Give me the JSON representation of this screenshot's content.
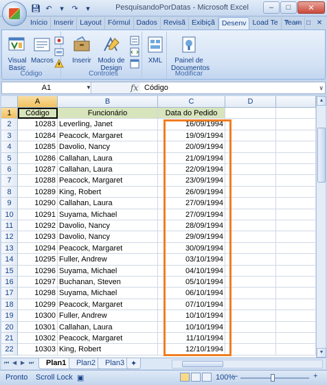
{
  "window": {
    "title": "PesquisandoPorDatas - Microsoft Excel",
    "minimize": "–",
    "maximize": "□",
    "close": "✕"
  },
  "tabs": [
    "Início",
    "Inserir",
    "Layout",
    "Fórmul",
    "Dados",
    "Revisã",
    "Exibiçã",
    "Desenv",
    "Load Te",
    "Team"
  ],
  "active_tab": "Desenv",
  "ribbon": {
    "groups": [
      {
        "label": "Código",
        "buttons": [
          "Visual Basic",
          "Macros"
        ]
      },
      {
        "label": "Controles",
        "buttons": [
          "Inserir",
          "Modo de Design"
        ]
      },
      {
        "label": "",
        "buttons": [
          "XML"
        ]
      },
      {
        "label": "Modificar",
        "buttons": [
          "Painel de Documentos"
        ]
      }
    ]
  },
  "formula_bar": {
    "name_box": "A1",
    "fx": "fx",
    "value": "Código"
  },
  "columns": [
    "A",
    "B",
    "C",
    "D"
  ],
  "header_row": {
    "row": "1",
    "A": "Código",
    "B": "Funcionário",
    "C": "Data do Pedido"
  },
  "rows": [
    {
      "row": "2",
      "A": "10283",
      "B": "Leverling, Janet",
      "C": "16/09/1994"
    },
    {
      "row": "3",
      "A": "10284",
      "B": "Peacock, Margaret",
      "C": "19/09/1994"
    },
    {
      "row": "4",
      "A": "10285",
      "B": "Davolio, Nancy",
      "C": "20/09/1994"
    },
    {
      "row": "5",
      "A": "10286",
      "B": "Callahan, Laura",
      "C": "21/09/1994"
    },
    {
      "row": "6",
      "A": "10287",
      "B": "Callahan, Laura",
      "C": "22/09/1994"
    },
    {
      "row": "7",
      "A": "10288",
      "B": "Peacock, Margaret",
      "C": "23/09/1994"
    },
    {
      "row": "8",
      "A": "10289",
      "B": "King, Robert",
      "C": "26/09/1994"
    },
    {
      "row": "9",
      "A": "10290",
      "B": "Callahan, Laura",
      "C": "27/09/1994"
    },
    {
      "row": "10",
      "A": "10291",
      "B": "Suyama, Michael",
      "C": "27/09/1994"
    },
    {
      "row": "11",
      "A": "10292",
      "B": "Davolio, Nancy",
      "C": "28/09/1994"
    },
    {
      "row": "12",
      "A": "10293",
      "B": "Davolio, Nancy",
      "C": "29/09/1994"
    },
    {
      "row": "13",
      "A": "10294",
      "B": "Peacock, Margaret",
      "C": "30/09/1994"
    },
    {
      "row": "14",
      "A": "10295",
      "B": "Fuller, Andrew",
      "C": "03/10/1994"
    },
    {
      "row": "15",
      "A": "10296",
      "B": "Suyama, Michael",
      "C": "04/10/1994"
    },
    {
      "row": "16",
      "A": "10297",
      "B": "Buchanan, Steven",
      "C": "05/10/1994"
    },
    {
      "row": "17",
      "A": "10298",
      "B": "Suyama, Michael",
      "C": "06/10/1994"
    },
    {
      "row": "18",
      "A": "10299",
      "B": "Peacock, Margaret",
      "C": "07/10/1994"
    },
    {
      "row": "19",
      "A": "10300",
      "B": "Fuller, Andrew",
      "C": "10/10/1994"
    },
    {
      "row": "20",
      "A": "10301",
      "B": "Callahan, Laura",
      "C": "10/10/1994"
    },
    {
      "row": "21",
      "A": "10302",
      "B": "Peacock, Margaret",
      "C": "11/10/1994"
    },
    {
      "row": "22",
      "A": "10303",
      "B": "King, Robert",
      "C": "12/10/1994"
    }
  ],
  "sheet_tabs": [
    "Plan1",
    "Plan2",
    "Plan3"
  ],
  "active_sheet": "Plan1",
  "status": {
    "mode": "Pronto",
    "scroll_lock": "Scroll Lock",
    "zoom": "100%",
    "zoom_out": "–",
    "zoom_in": "+"
  },
  "colors": {
    "highlight_box": "#f07d1f",
    "header_fill": "#d8e4bc",
    "selected_header": "#f1c15f"
  }
}
